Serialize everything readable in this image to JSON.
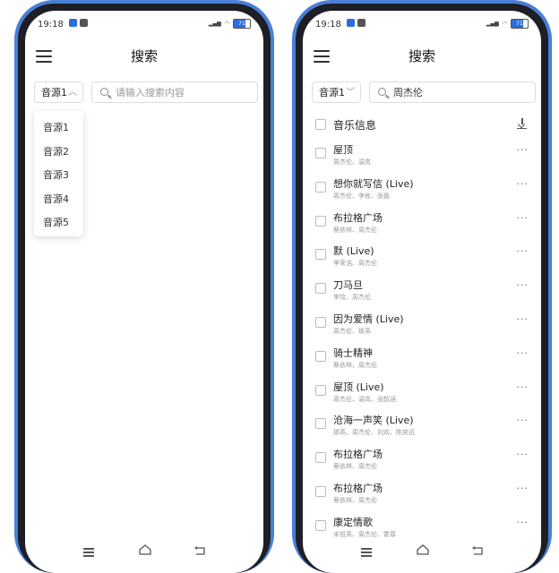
{
  "left": {
    "status": {
      "time": "19:18",
      "battery": "71"
    },
    "title": "搜索",
    "source": "音源1",
    "search_placeholder": "请输入搜索内容",
    "dropdown_options": [
      "音源1",
      "音源2",
      "音源3",
      "音源4",
      "音源5"
    ]
  },
  "right": {
    "status": {
      "time": "19:18",
      "battery": "71"
    },
    "title": "搜索",
    "source": "音源1",
    "search_value": "周杰伦",
    "list_header": "音乐信息",
    "songs": [
      {
        "title": "屋顶",
        "artist": "周杰伦、温岚"
      },
      {
        "title": "想你就写信 (Live)",
        "artist": "周杰伦、李栋、张磊"
      },
      {
        "title": "布拉格广场",
        "artist": "蔡依林、周杰伦"
      },
      {
        "title": "默 (Live)",
        "artist": "李荣浩、周杰伦"
      },
      {
        "title": "刀马旦",
        "artist": "李玟、周杰伦"
      },
      {
        "title": "因为爱情 (Live)",
        "artist": "周杰伦、那英"
      },
      {
        "title": "骑士精神",
        "artist": "蔡依林、周杰伦"
      },
      {
        "title": "屋顶 (Live)",
        "artist": "周杰伦、温岚、张韶涵"
      },
      {
        "title": "沧海一声笑 (Live)",
        "artist": "那英、周杰伦、刘欢、陈奕迅"
      },
      {
        "title": "布拉格广场",
        "artist": "蔡依林、周杰伦"
      },
      {
        "title": "布拉格广场",
        "artist": "蔡依林、周杰伦"
      },
      {
        "title": "康定情歌",
        "artist": "宋祖英、周杰伦、霍尊"
      }
    ]
  },
  "colors": {
    "frame": "#4a7fd6",
    "bezel": "#1d1f24",
    "battery": "#2f6cd9"
  },
  "icons": [
    "menu-icon",
    "search-icon",
    "chevron-icon",
    "download-icon",
    "more-icon",
    "nav-menu-icon",
    "nav-home-icon",
    "nav-back-icon"
  ]
}
